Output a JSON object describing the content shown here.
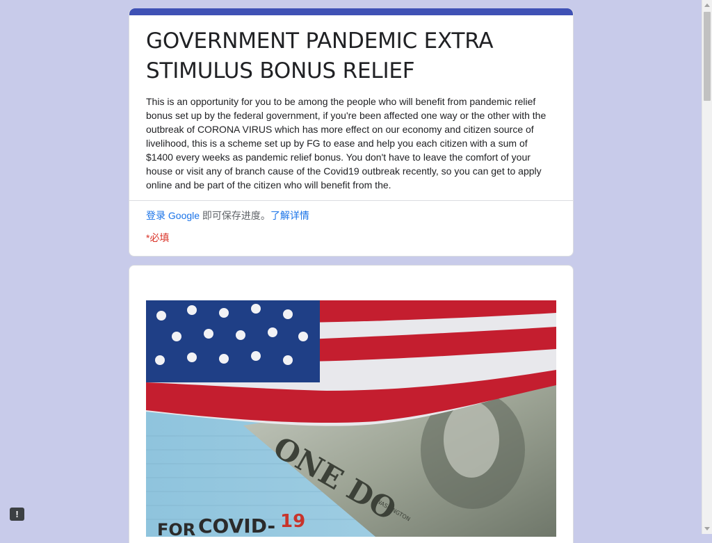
{
  "form": {
    "title": "GOVERNMENT PANDEMIC EXTRA STIMULUS BONUS RELIEF",
    "description": "This is an opportunity for you to be among the people who will benefit from pandemic relief bonus set up by the federal government, if you're been affected one way or the other with the outbreak of CORONA VIRUS which has more effect on our economy and citizen source of livelihood, this is a scheme set up by FG to ease and help you each citizen with a sum of $1400 every weeks as pandemic relief bonus. You don't have to leave the comfort of your house or visit any of branch cause of the Covid19 outbreak recently, so you can get to apply online and be part of the citizen who will benefit from the.",
    "signin_link": "登录 Google",
    "signin_text": " 即可保存进度。",
    "learn_more": "了解详情",
    "required_note": "*必填"
  },
  "image": {
    "banknote_text": "ONE DO",
    "washington_text": "WASHINGTON",
    "covid_prefix": "FOR ",
    "covid_text": "COVID-",
    "covid_num": "19"
  },
  "report_button": {
    "label": "!"
  },
  "colors": {
    "background": "#c8cbea",
    "accent": "#3f51b5",
    "link": "#1a73e8",
    "required": "#d93025"
  }
}
